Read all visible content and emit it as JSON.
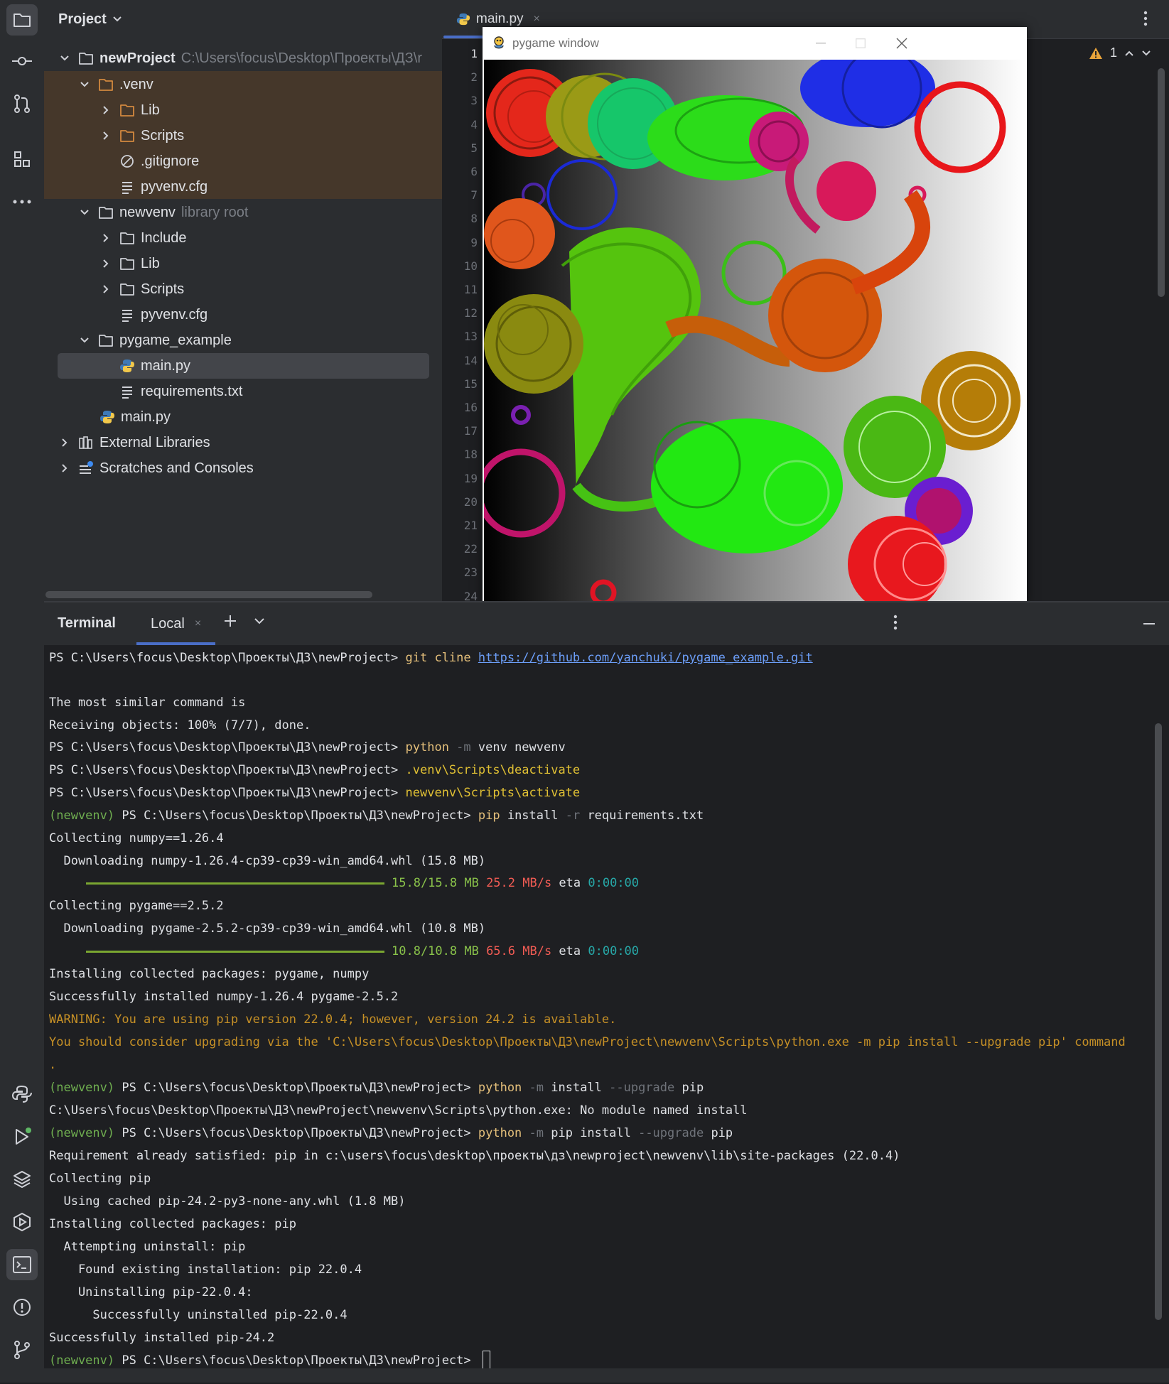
{
  "project": {
    "header": "Project",
    "tree": [
      {
        "label": "newProject",
        "path": "C:\\Users\\focus\\Desktop\\Проекты\\ДЗ\\r",
        "bold": true
      },
      {
        "label": ".venv"
      },
      {
        "label": "Lib"
      },
      {
        "label": "Scripts"
      },
      {
        "label": ".gitignore"
      },
      {
        "label": "pyvenv.cfg"
      },
      {
        "label": "newvenv",
        "note": "library root"
      },
      {
        "label": "Include"
      },
      {
        "label": "Lib"
      },
      {
        "label": "Scripts"
      },
      {
        "label": "pyvenv.cfg"
      },
      {
        "label": "pygame_example"
      },
      {
        "label": "main.py"
      },
      {
        "label": "requirements.txt"
      },
      {
        "label": "main.py"
      },
      {
        "label": "External Libraries"
      },
      {
        "label": "Scratches and Consoles"
      }
    ]
  },
  "editor": {
    "tab_label": "main.py",
    "tab_close": "×",
    "warning_count": "1",
    "line_numbers": [
      "1",
      "2",
      "3",
      "4",
      "5",
      "6",
      "7",
      "8",
      "9",
      "10",
      "11",
      "12",
      "13",
      "14",
      "15",
      "16",
      "17",
      "18",
      "19",
      "20",
      "21",
      "22",
      "23",
      "24"
    ]
  },
  "pygame_window": {
    "title": "pygame window"
  },
  "terminal": {
    "title": "Terminal",
    "tab": "Local",
    "tab_close": "×",
    "lines": {
      "l1_prompt": "PS C:\\Users\\focus\\Desktop\\Проекты\\ДЗ\\newProject> ",
      "l1_cmd": "git cline ",
      "l1_url": "https://github.com/yanchuki/pygame_example.git",
      "l3": "The most similar command is",
      "l4": "Receiving objects: 100% (7/7), done.",
      "l5_prompt": "PS C:\\Users\\focus\\Desktop\\Проекты\\ДЗ\\newProject> ",
      "l5_cmd": "python",
      "l5_flag": " -m",
      "l5_rest": " venv newvenv",
      "l6_prompt": "PS C:\\Users\\focus\\Desktop\\Проекты\\ДЗ\\newProject> ",
      "l6_cmd": ".venv\\Scripts\\deactivate",
      "l7_prompt": "PS C:\\Users\\focus\\Desktop\\Проекты\\ДЗ\\newProject> ",
      "l7_cmd": "newvenv\\Scripts\\activate",
      "l8_env": "(newvenv)",
      "l8_prompt": " PS C:\\Users\\focus\\Desktop\\Проекты\\ДЗ\\newProject> ",
      "l8_cmd": "pip",
      "l8_a": " install",
      "l8_flag": " -r",
      "l8_rest": " requirements.txt",
      "l9": "Collecting numpy==1.26.4",
      "l10": "  Downloading numpy-1.26.4-cp39-cp39-win_amd64.whl (15.8 MB)",
      "l11_size": "15.8/15.8 MB",
      "l11_speed": " 25.2 MB/s",
      "l11_eta": " eta",
      "l11_time": " 0:00:00",
      "l12": "Collecting pygame==2.5.2",
      "l13": "  Downloading pygame-2.5.2-cp39-cp39-win_amd64.whl (10.8 MB)",
      "l14_size": "10.8/10.8 MB",
      "l14_speed": " 65.6 MB/s",
      "l14_eta": " eta",
      "l14_time": " 0:00:00",
      "l15": "Installing collected packages: pygame, numpy",
      "l16": "Successfully installed numpy-1.26.4 pygame-2.5.2",
      "l17": "WARNING: You are using pip version 22.0.4; however, version 24.2 is available.",
      "l18": "You should consider upgrading via the 'C:\\Users\\focus\\Desktop\\Проекты\\ДЗ\\newProject\\newvenv\\Scripts\\python.exe -m pip install --upgrade pip' command",
      "l19": ".",
      "l20_env": "(newvenv)",
      "l20_prompt": " PS C:\\Users\\focus\\Desktop\\Проекты\\ДЗ\\newProject> ",
      "l20_cmd": "python",
      "l20_flag": " -m",
      "l20_a": " install",
      "l20_flag2": " --upgrade",
      "l20_rest": " pip",
      "l21": "C:\\Users\\focus\\Desktop\\Проекты\\ДЗ\\newProject\\newvenv\\Scripts\\python.exe: No module named install",
      "l22_env": "(newvenv)",
      "l22_prompt": " PS C:\\Users\\focus\\Desktop\\Проекты\\ДЗ\\newProject> ",
      "l22_cmd": "python",
      "l22_flag": " -m",
      "l22_a": " pip install",
      "l22_flag2": " --upgrade",
      "l22_rest": " pip",
      "l23": "Requirement already satisfied: pip in c:\\users\\focus\\desktop\\проекты\\дз\\newproject\\newvenv\\lib\\site-packages (22.0.4)",
      "l24": "Collecting pip",
      "l25": "  Using cached pip-24.2-py3-none-any.whl (1.8 MB)",
      "l26": "Installing collected packages: pip",
      "l27": "  Attempting uninstall: pip",
      "l28": "    Found existing installation: pip 22.0.4",
      "l29": "    Uninstalling pip-22.0.4:",
      "l30": "      Successfully uninstalled pip-22.0.4",
      "l31": "Successfully installed pip-24.2",
      "l32_env": "(newvenv)",
      "l32_prompt": " PS C:\\Users\\focus\\Desktop\\Проекты\\ДЗ\\newProject> "
    }
  },
  "colors": {
    "accent": "#4a6ec7",
    "venv_highlight": "#45372a",
    "warning": "#c69026",
    "env_green": "#6fae50",
    "command_yellow": "#e5c07b"
  }
}
